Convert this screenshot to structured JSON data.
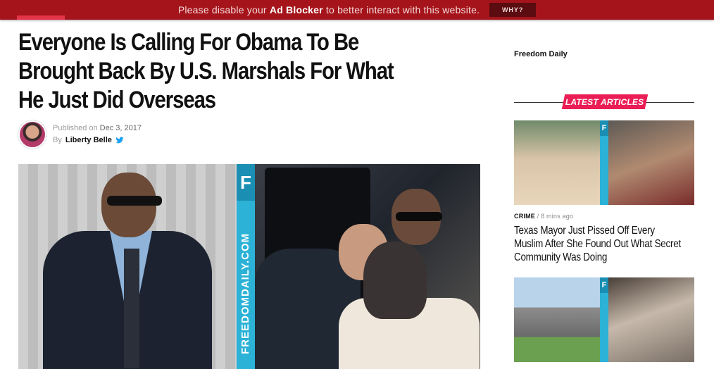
{
  "adblock": {
    "text_before": "Please disable your ",
    "text_bold": "Ad Blocker",
    "text_after": " to better interact with this website.",
    "button_label": "WHY?"
  },
  "article": {
    "headline": "Everyone Is Calling For Obama To Be Brought Back By U.S. Marshals For What He Just Did Overseas",
    "published_prefix": "Published on",
    "published_date": "Dec 3, 2017",
    "by_prefix": "By",
    "author": "Liberty Belle"
  },
  "hero": {
    "watermark_letter": "F",
    "watermark_text": "FREEDOMDAILY.COM"
  },
  "sidebar": {
    "site_name": "Freedom Daily",
    "section_label": "LATEST ARTICLES",
    "articles": [
      {
        "category": "CRIME",
        "separator": "/",
        "time": "8 mins ago",
        "title": "Texas Mayor Just Pissed Off Every Muslim After She Found Out What Secret Community Was Doing"
      }
    ],
    "thumb_letter": "F"
  },
  "colors": {
    "adbar": "#a5141a",
    "accent_pink": "#ea1d55",
    "watermark_blue": "#2bb2d6",
    "twitter_blue": "#1da1f2"
  }
}
